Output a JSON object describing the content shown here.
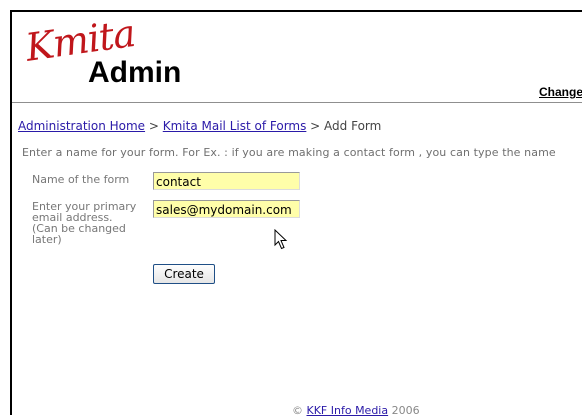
{
  "header": {
    "logo_script": "Kmita",
    "logo_word": "Admin",
    "change_link": "Change"
  },
  "breadcrumb": {
    "home": "Administration Home",
    "sep1": " > ",
    "list": "Kmita Mail List of Forms",
    "sep2": " > ",
    "current": "Add Form"
  },
  "instruction": "Enter a name for your form. For Ex. : if you are making a contact form , you can type the name",
  "form": {
    "name_label": "Name of the form",
    "name_value": "contact",
    "email_label_lines": [
      "Enter your primary",
      "email address.",
      "(Can be changed",
      "later)"
    ],
    "email_value": "sales@mydomain.com",
    "create_button": "Create"
  },
  "footer": {
    "prefix": "© ",
    "link": "KKF Info Media",
    "year": " 2006"
  },
  "colors": {
    "logo_red": "#c0161b",
    "link_blue": "#2a1aa8",
    "input_yellow": "#fffea9"
  }
}
